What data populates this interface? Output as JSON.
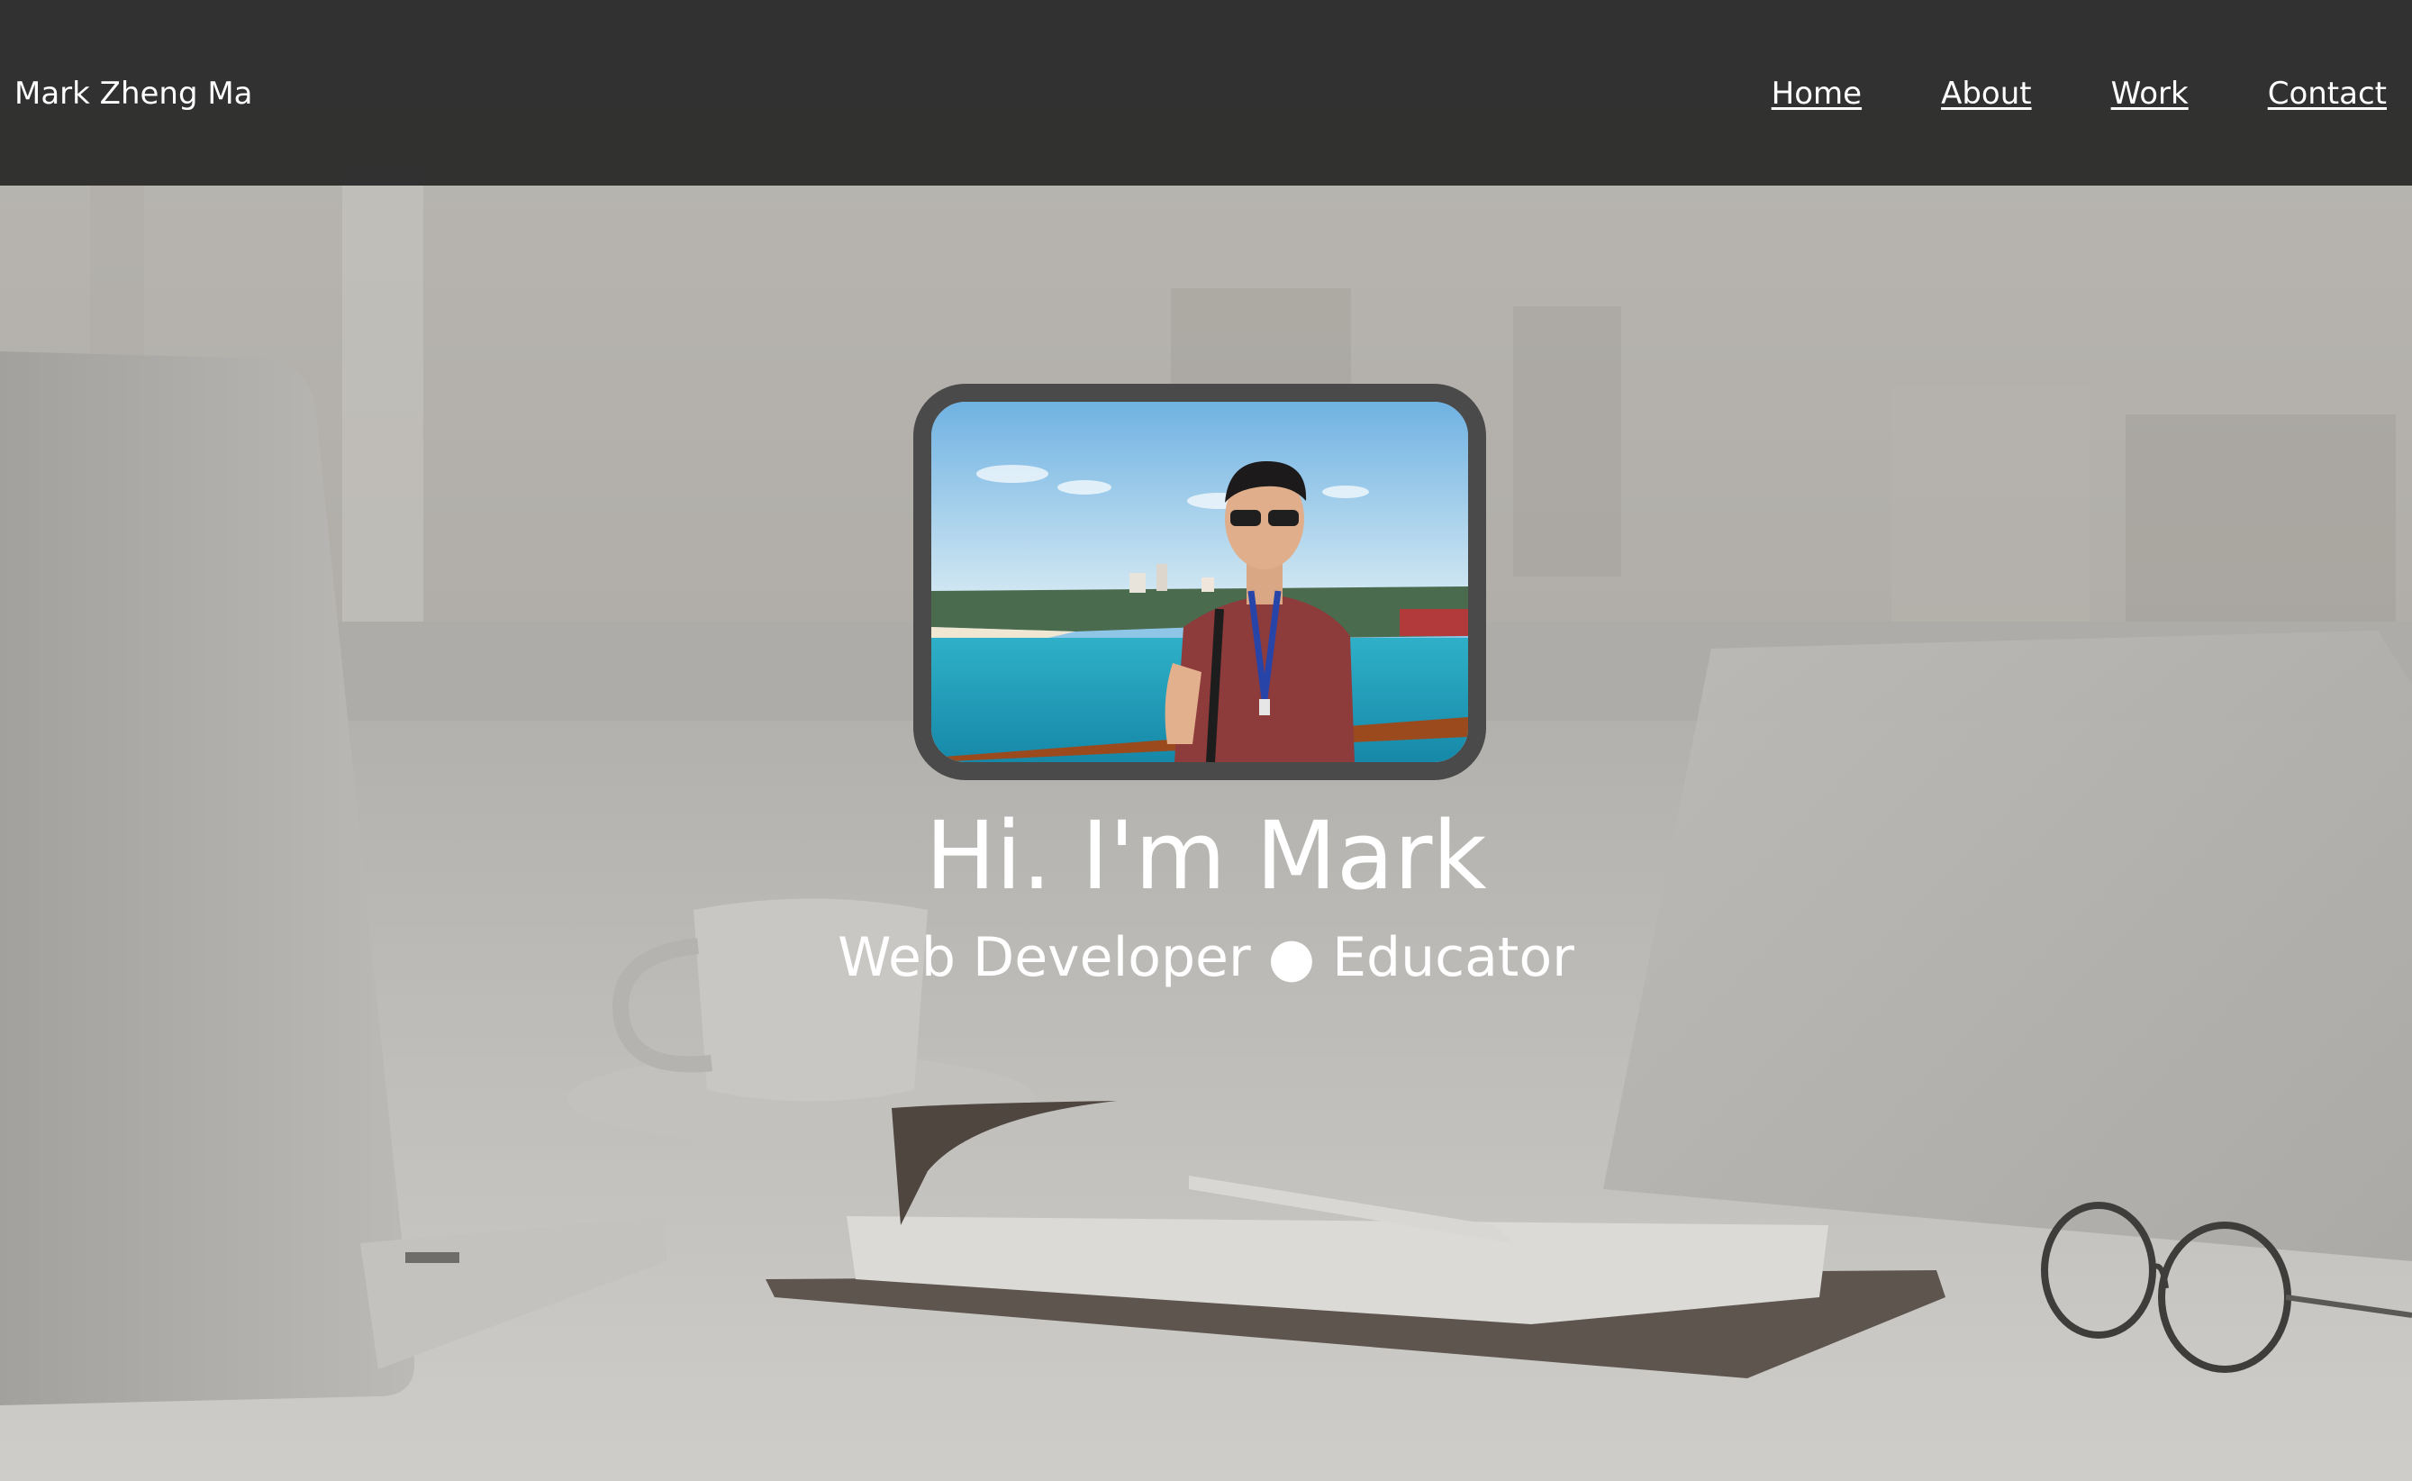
{
  "header": {
    "brand": "Mark Zheng Ma",
    "nav": [
      {
        "label": "Home"
      },
      {
        "label": "About"
      },
      {
        "label": "Work"
      },
      {
        "label": "Contact"
      }
    ]
  },
  "hero": {
    "title": "Hi. I'm Mark",
    "subtitle": "Web Developer ● Educator"
  },
  "colors": {
    "header_bg": "#282828",
    "text": "#ffffff",
    "avatar_border": "#4a4a4a"
  }
}
